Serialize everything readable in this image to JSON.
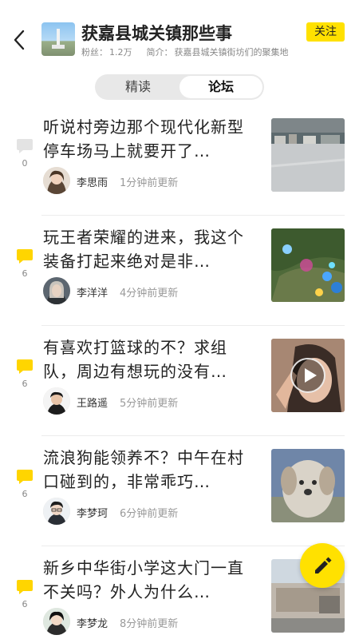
{
  "header": {
    "title": "获嘉县城关镇那些事",
    "fans_label": "粉丝：",
    "fans_count": "1.2万",
    "intro_label": "简介：",
    "intro_text": "获嘉县城关镇街坊们的聚集地",
    "follow_label": "关注",
    "accent_color": "#ffe100"
  },
  "tabs": [
    {
      "label": "精读",
      "active": false
    },
    {
      "label": "论坛",
      "active": true
    }
  ],
  "posts": [
    {
      "title": "听说村旁边那个现代化新型停车场马上就要开了…",
      "comments": "0",
      "author": "李思雨",
      "time": "1分钟前更新",
      "comment_icon": "speech-bubble-gray",
      "thumb": "parking-lot-photo"
    },
    {
      "title": "玩王者荣耀的进来，我这个装备打起来绝对是非…",
      "comments": "6",
      "author": "李洋洋",
      "time": "4分钟前更新",
      "comment_icon": "speech-bubble-yellow",
      "thumb": "game-screenshot"
    },
    {
      "title": "有喜欢打篮球的不？求组队，周边有想玩的没有…",
      "comments": "6",
      "author": "王路遥",
      "time": "5分钟前更新",
      "comment_icon": "speech-bubble-yellow",
      "thumb": "video-selfie"
    },
    {
      "title": "流浪狗能领养不？中午在村口碰到的，非常乖巧…",
      "comments": "6",
      "author": "李梦珂",
      "time": "6分钟前更新",
      "comment_icon": "speech-bubble-yellow",
      "thumb": "dog-photo"
    },
    {
      "title": "新乡中华街小学这大门一直不关吗？外人为什么…",
      "comments": "6",
      "author": "李梦龙",
      "time": "8分钟前更新",
      "comment_icon": "speech-bubble-yellow",
      "thumb": "school-gate-photo"
    }
  ],
  "fab": {
    "icon": "pencil-icon"
  }
}
